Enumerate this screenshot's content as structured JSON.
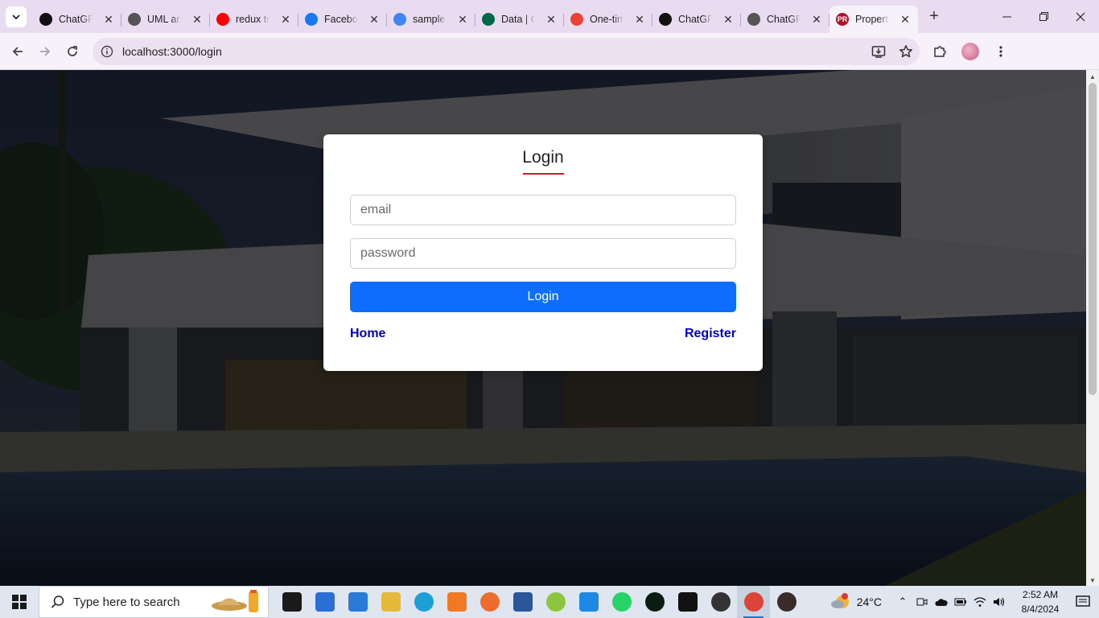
{
  "browser": {
    "tabs": [
      {
        "title": "ChatGPT",
        "favicon": "chatgpt-icon",
        "color": "#111111"
      },
      {
        "title": "UML and",
        "favicon": "chatgpt-icon",
        "color": "#555555"
      },
      {
        "title": "redux toolkit",
        "favicon": "youtube-icon",
        "color": "#ff0000"
      },
      {
        "title": "Facebook",
        "favicon": "facebook-icon",
        "color": "#1877f2"
      },
      {
        "title": "sample",
        "favicon": "google-icon",
        "color": "#4285f4"
      },
      {
        "title": "Data | Cloud",
        "favicon": "mongodb-icon",
        "color": "#00684a"
      },
      {
        "title": "One-time",
        "favicon": "gmail-icon",
        "color": "#ea4335"
      },
      {
        "title": "ChatGPT",
        "favicon": "chatgpt-icon",
        "color": "#111111"
      },
      {
        "title": "ChatGPT",
        "favicon": "chatgpt-icon",
        "color": "#555555"
      },
      {
        "title": "Property",
        "favicon": "pr-icon",
        "color": "#b0122a",
        "initials": "PR",
        "active": true
      }
    ],
    "url": "localhost:3000/login"
  },
  "login": {
    "title": "Login",
    "email_placeholder": "email",
    "password_placeholder": "password",
    "submit_label": "Login",
    "home_link": "Home",
    "register_link": "Register"
  },
  "colors": {
    "accent": "#0d6efd",
    "underline": "#e3122b",
    "link": "#0000cc"
  },
  "taskbar": {
    "search_placeholder": "Type here to search",
    "apps": [
      "task-view-icon",
      "store-icon",
      "mail-icon",
      "file-explorer-icon",
      "edge-icon",
      "xampp-icon",
      "postman-icon",
      "word-icon",
      "cloud-app-icon",
      "vscode-icon",
      "whatsapp-icon",
      "mongodb-compass-icon",
      "capcut-icon",
      "obs-icon",
      "chrome-icon",
      "media-player-icon"
    ],
    "weather_temp": "24°C",
    "time": "2:52 AM",
    "date": "8/4/2024"
  }
}
